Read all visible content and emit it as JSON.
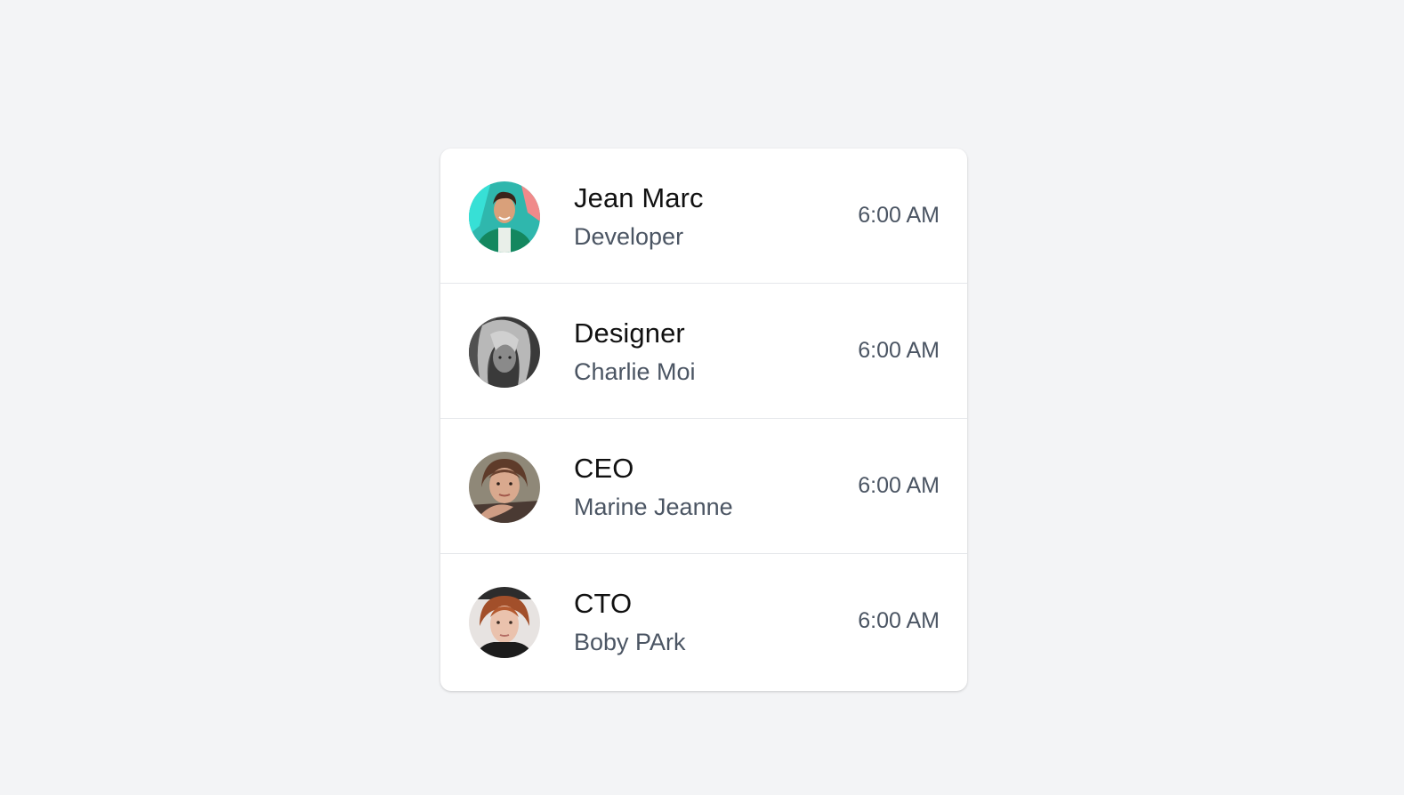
{
  "contacts": [
    {
      "title": "Jean Marc",
      "subtitle": "Developer",
      "time": "6:00 AM",
      "avatar": "avatar-photo-jean-marc"
    },
    {
      "title": "Designer",
      "subtitle": "Charlie Moi",
      "time": "6:00 AM",
      "avatar": "avatar-photo-charlie-moi"
    },
    {
      "title": "CEO",
      "subtitle": "Marine Jeanne",
      "time": "6:00 AM",
      "avatar": "avatar-photo-marine-jeanne"
    },
    {
      "title": "CTO",
      "subtitle": "Boby PArk",
      "time": "6:00 AM",
      "avatar": "avatar-photo-boby-park"
    }
  ],
  "colors": {
    "background": "#f3f4f6",
    "card": "#ffffff",
    "divider": "#e5e7eb",
    "title_text": "#111111",
    "secondary_text": "#4b5563"
  }
}
